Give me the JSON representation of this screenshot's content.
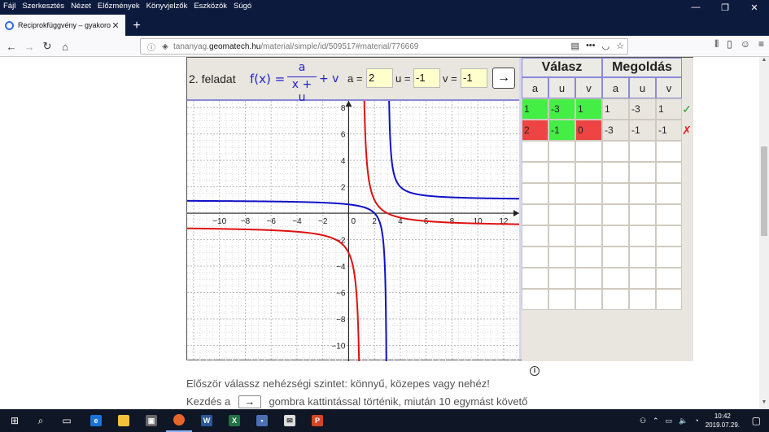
{
  "menu": [
    "Fájl",
    "Szerkesztés",
    "Nézet",
    "Előzmények",
    "Könyvjelzők",
    "Eszközök",
    "Súgó"
  ],
  "tab": {
    "title": "Reciprokfüggvény – gyakorolta"
  },
  "url": {
    "prefix": "tananyag.",
    "host": "geomatech.hu",
    "path": "/material/simple/id/509517#material/776669"
  },
  "task": {
    "label": "2. feladat",
    "formula_fx": "f(x) =",
    "formula_num": "a",
    "formula_den": "x + u",
    "formula_tail": "+ v",
    "a_label": "a =",
    "a_value": "2",
    "u_label": "u =",
    "u_value": "-1",
    "v_label": "v =",
    "v_value": "-1",
    "go": "→"
  },
  "graph": {
    "x_ticks": [
      "−10",
      "−8",
      "−6",
      "−4",
      "−2",
      "0",
      "2",
      "4",
      "6",
      "8",
      "10",
      "12"
    ],
    "y_ticks": [
      "8",
      "6",
      "4",
      "2",
      "0",
      "−2",
      "−4",
      "−6",
      "−8",
      "−10"
    ],
    "xlim": [
      -12.5,
      13.2
    ],
    "ylim": [
      -11.2,
      8.5
    ],
    "curves": [
      {
        "a": 1,
        "u": -3,
        "v": 1,
        "color": "#1010c8"
      },
      {
        "a": 2,
        "u": -1,
        "v": -1,
        "color": "#e01010"
      }
    ]
  },
  "table": {
    "col1": "Válasz",
    "col2": "Megoldás",
    "subheaders": [
      "a",
      "u",
      "v",
      "a",
      "u",
      "v"
    ],
    "rows": [
      {
        "values": [
          "1",
          "-3",
          "1",
          "1",
          "-3",
          "1"
        ],
        "colors": [
          "#44ee44",
          "#44ee44",
          "#44ee44",
          "#e9e6df",
          "#e9e6df",
          "#e9e6df"
        ],
        "mark": "✓",
        "mark_color": "#2aa02a"
      },
      {
        "values": [
          "2",
          "-1",
          "0",
          "-3",
          "-1",
          "-1"
        ],
        "colors": [
          "#ee4444",
          "#44ee44",
          "#ee4444",
          "#e9e6df",
          "#e9e6df",
          "#e9e6df"
        ],
        "mark": "✗",
        "mark_color": "#e02020"
      }
    ]
  },
  "info": "i",
  "text": {
    "line1": "Először válassz nehézségi szintet: könnyű, közepes vagy nehéz!",
    "line2_a": "Kezdés a",
    "line2_b": "→",
    "line2_c": "gombra kattintással történik, miután 10 egymást követő"
  },
  "clock": {
    "time": "10:42",
    "date": "2019.07.29."
  }
}
